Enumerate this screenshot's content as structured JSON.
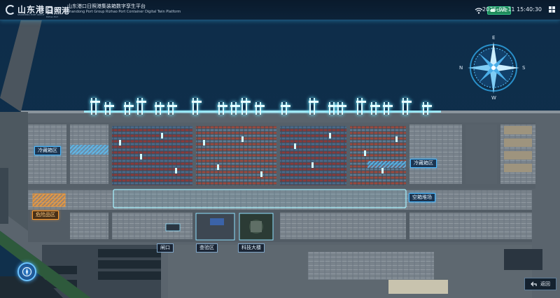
{
  "header": {
    "logo_primary": "山东港口",
    "logo_primary_sub": "SHANDONG PORT GROUP",
    "logo_secondary": "日照港",
    "logo_secondary_sub": "Rizhao Port",
    "title": "山东港口日照港集装箱数字孪生平台",
    "subtitle": "Shandong Port Group Rizhao Port Container Digital Twin Platform",
    "live_label": "LIVE",
    "datetime": "2026-08-11  15:40:30"
  },
  "compass": {
    "n": "N",
    "s": "S",
    "e": "E",
    "w": "W"
  },
  "zones": {
    "cold_left": "冷藏箱区",
    "cold_right": "冷藏箱区",
    "hazard": "危险品区",
    "empty_yard": "空箱堆场",
    "gate": "闸口",
    "inspection": "查验区",
    "tech_building": "科技大楼"
  },
  "controls": {
    "back_label": "返回"
  },
  "colors": {
    "accent": "#47b7ff",
    "hazard": "#ff9a2a",
    "live": "#1e8a5a",
    "sea": "#0d2a45"
  },
  "icons": {
    "wifi": "wifi-icon",
    "camera": "camera-icon",
    "fullscreen": "fullscreen-icon",
    "back": "back-arrow-icon",
    "compass": "compass-rose-icon",
    "navigation": "navigation-icon"
  }
}
